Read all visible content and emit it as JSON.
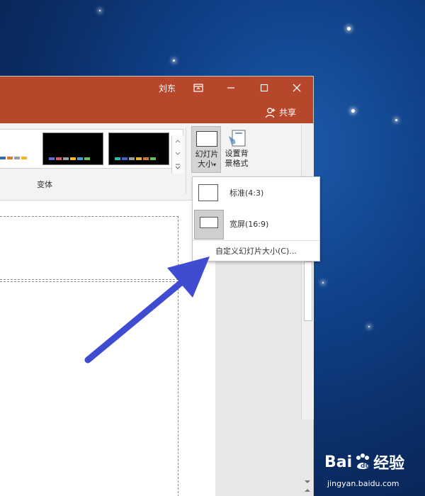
{
  "window": {
    "user": "刘东",
    "share": "共享"
  },
  "ribbon": {
    "variants_label": "变体",
    "slide_size_label_1": "幻灯片",
    "slide_size_label_2": "大小",
    "format_bg_label_1": "设置背",
    "format_bg_label_2": "景格式"
  },
  "menu": {
    "standard": "标准(4:3)",
    "widescreen": "宽屏(16:9)",
    "custom": "自定义幻灯片大小(C)..."
  },
  "watermark": {
    "brand_text": "Bai",
    "brand_suffix": "经验",
    "url": "jingyan.baidu.com"
  },
  "colors": {
    "titlebar": "#b7472a",
    "arrow": "#3f4bd0"
  }
}
